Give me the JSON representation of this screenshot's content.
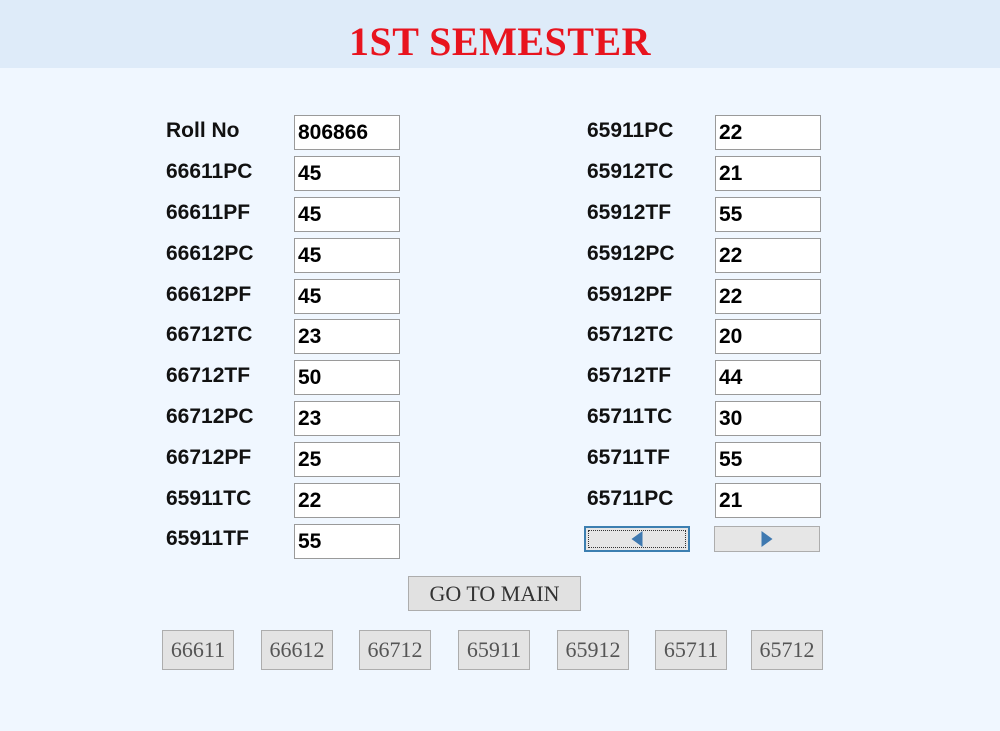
{
  "title": "1ST SEMESTER",
  "left_fields": [
    {
      "label": "Roll No",
      "value": "806866"
    },
    {
      "label": "66611PC",
      "value": "45"
    },
    {
      "label": "66611PF",
      "value": "45"
    },
    {
      "label": "66612PC",
      "value": "45"
    },
    {
      "label": "66612PF",
      "value": "45"
    },
    {
      "label": "66712TC",
      "value": "23"
    },
    {
      "label": "66712TF",
      "value": "50"
    },
    {
      "label": "66712PC",
      "value": "23"
    },
    {
      "label": "66712PF",
      "value": "25"
    },
    {
      "label": "65911TC",
      "value": "22"
    },
    {
      "label": "65911TF",
      "value": "55"
    }
  ],
  "right_fields": [
    {
      "label": "65911PC",
      "value": "22"
    },
    {
      "label": "65912TC",
      "value": "21"
    },
    {
      "label": "65912TF",
      "value": "55"
    },
    {
      "label": "65912PC",
      "value": "22"
    },
    {
      "label": "65912PF",
      "value": "22"
    },
    {
      "label": "65712TC",
      "value": "20"
    },
    {
      "label": "65712TF",
      "value": "44"
    },
    {
      "label": "65711TC",
      "value": "30"
    },
    {
      "label": "65711TF",
      "value": "55"
    },
    {
      "label": "65711PC",
      "value": "21"
    }
  ],
  "navigation": {
    "prev_icon": "triangle-left-icon",
    "next_icon": "triangle-right-icon",
    "icon_color": "#3f79b0"
  },
  "main_button_label": "GO TO MAIN",
  "course_buttons": [
    "66611",
    "66612",
    "66712",
    "65911",
    "65912",
    "65711",
    "65712"
  ],
  "colors": {
    "title": "#e8141e",
    "header_band": "#deebf9",
    "background": "#f0f7ff"
  }
}
